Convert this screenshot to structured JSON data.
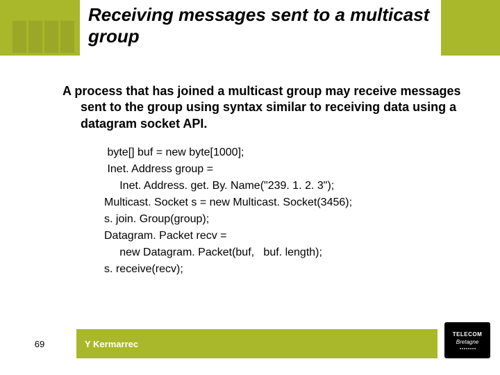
{
  "header": {
    "title": "Receiving messages sent to a multicast group"
  },
  "body": {
    "paragraph": "A process that has joined a multicast group may receive messages sent to the group using syntax similar to receiving data using a datagram socket API.",
    "code": [
      " byte[] buf = new byte[1000];",
      " Inet. Address group =",
      "     Inet. Address. get. By. Name(\"239. 1. 2. 3\");",
      "Multicast. Socket s = new Multicast. Socket(3456);",
      "s. join. Group(group);",
      "Datagram. Packet recv =",
      "     new Datagram. Packet(buf,   buf. length);",
      "s. receive(recv);"
    ]
  },
  "footer": {
    "slide_number": "69",
    "author": "Y Kermarrec",
    "logo_top": "TELECOM",
    "logo_bottom": "Bretagne"
  }
}
